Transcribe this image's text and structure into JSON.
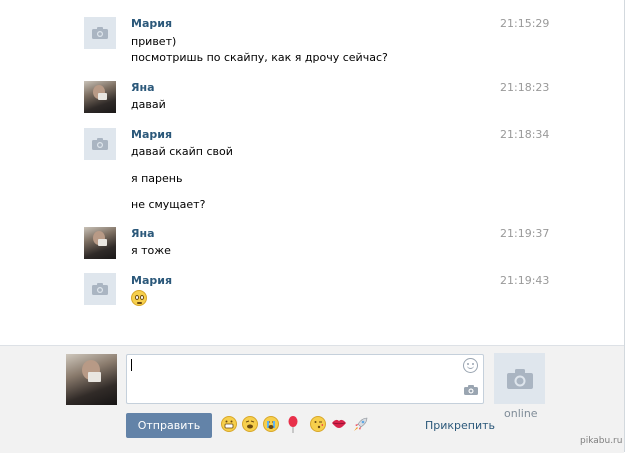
{
  "messages": [
    {
      "author": "Мария",
      "time": "21:15:29",
      "lines": [
        "привет)",
        "посмотришь по скайпу, как я дрочу сейчас?"
      ],
      "avatar": "camera-placeholder"
    },
    {
      "author": "Яна",
      "time": "21:18:23",
      "lines": [
        "давай"
      ],
      "avatar": "photo"
    },
    {
      "author": "Мария",
      "time": "21:18:34",
      "lines": [
        "давай скайп свой",
        "я парень",
        "не смущает?"
      ],
      "avatar": "camera-placeholder"
    },
    {
      "author": "Яна",
      "time": "21:19:37",
      "lines": [
        "я тоже"
      ],
      "avatar": "photo"
    },
    {
      "author": "Мария",
      "time": "21:19:43",
      "lines": [],
      "emoji": "rolling-eyes-emoji",
      "avatar": "camera-placeholder"
    }
  ],
  "composer": {
    "input_value": "",
    "send_label": "Отправить",
    "attach_label": "Прикрепить",
    "emoji_bar": [
      "grin-emoji",
      "tired-emoji",
      "crying-emoji",
      "balloon-emoji",
      "wink-kiss-emoji",
      "lips-emoji",
      "rocket-emoji"
    ],
    "partner_status": "online"
  },
  "watermark": "pikabu.ru",
  "colors": {
    "author_name": "#2b587a",
    "timestamp": "#999999",
    "send_button": "#6383a8",
    "composer_bg": "#f2f2f2",
    "avatar_placeholder": "#dfe6ed"
  }
}
